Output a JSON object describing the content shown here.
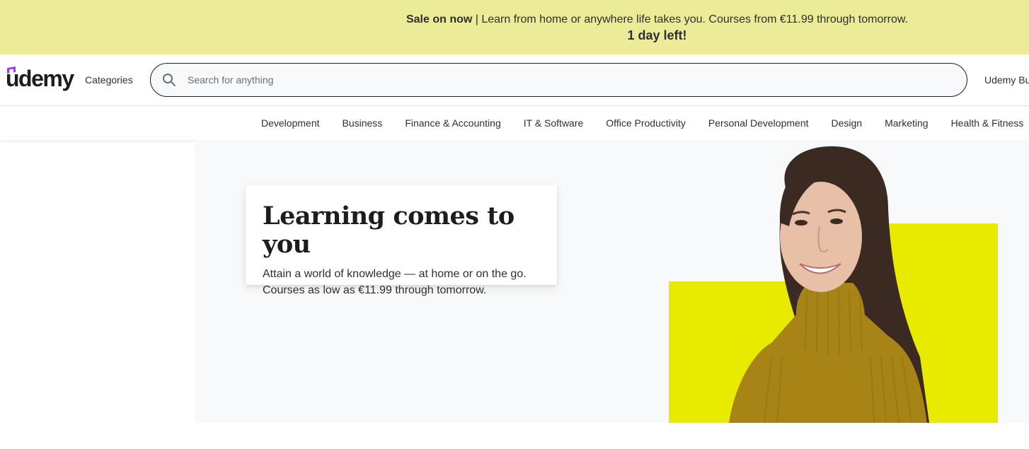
{
  "banner": {
    "sale_label": "Sale on now",
    "separator": " | ",
    "message": "Learn from home or anywhere life takes you. Courses from €11.99 through tomorrow.",
    "countdown": "1 day left!",
    "background_color": "#eceb98"
  },
  "header": {
    "logo_text": "udemy",
    "categories_label": "Categories",
    "search_placeholder": "Search for anything",
    "search_icon": "search-icon",
    "udemy_business_label": "Udemy Bu"
  },
  "category_nav": {
    "items": [
      {
        "label": "Development"
      },
      {
        "label": "Business"
      },
      {
        "label": "Finance & Accounting"
      },
      {
        "label": "IT & Software"
      },
      {
        "label": "Office Productivity"
      },
      {
        "label": "Personal Development"
      },
      {
        "label": "Design"
      },
      {
        "label": "Marketing"
      },
      {
        "label": "Health & Fitness"
      }
    ]
  },
  "hero": {
    "title": "Learning comes to you",
    "subtitle_line1": "Attain a world of knowledge — at home or on the go.",
    "subtitle_line2": "Courses as low as €11.99 through tomorrow.",
    "accent_color": "#e8ea00",
    "image": "woman-smiling-photo"
  },
  "colors": {
    "brand_purple": "#a435f0",
    "text_dark": "#1c1d1f"
  }
}
